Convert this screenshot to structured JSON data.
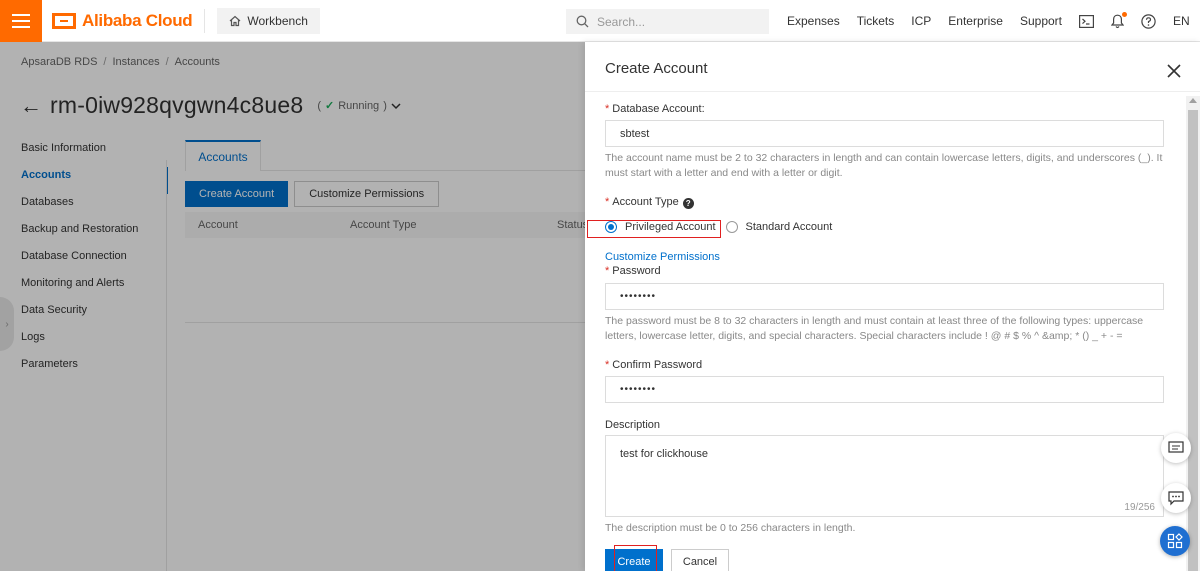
{
  "header": {
    "brand": "Alibaba Cloud",
    "workbench": "Workbench",
    "search_placeholder": "Search...",
    "nav": [
      "Expenses",
      "Tickets",
      "ICP",
      "Enterprise",
      "Support"
    ],
    "language": "EN",
    "accent_color": "#ff6a00"
  },
  "breadcrumb": [
    "ApsaraDB RDS",
    "Instances",
    "Accounts"
  ],
  "instance": {
    "id": "rm-0iw928qvgwn4c8ue8",
    "status": "Running"
  },
  "sidebar": {
    "items": [
      {
        "label": "Basic Information",
        "active": false
      },
      {
        "label": "Accounts",
        "active": true
      },
      {
        "label": "Databases",
        "active": false
      },
      {
        "label": "Backup and Restoration",
        "active": false
      },
      {
        "label": "Database Connection",
        "active": false
      },
      {
        "label": "Monitoring and Alerts",
        "active": false
      },
      {
        "label": "Data Security",
        "active": false
      },
      {
        "label": "Logs",
        "active": false
      },
      {
        "label": "Parameters",
        "active": false
      }
    ]
  },
  "main": {
    "tab": "Accounts",
    "create_button": "Create Account",
    "customize_button": "Customize Permissions",
    "columns": [
      "Account",
      "Account Type",
      "Status"
    ]
  },
  "drawer": {
    "title": "Create Account",
    "db_account": {
      "label": "Database Account:",
      "value": "sbtest",
      "help": "The account name must be 2 to 32 characters in length and can contain lowercase letters, digits, and underscores (_). It must start with a letter and end with a letter or digit."
    },
    "account_type": {
      "label": "Account Type",
      "options": [
        "Privileged Account",
        "Standard Account"
      ],
      "selected": "Privileged Account"
    },
    "customize_link": "Customize Permissions",
    "password": {
      "label": "Password",
      "value": "••••••••",
      "help": "The password must be 8 to 32 characters in length and must contain at least three of the following types: uppercase letters, lowercase letter, digits, and special characters. Special characters include ! @ # $ % ^ &amp; * () _ + - ="
    },
    "confirm_password": {
      "label": "Confirm Password",
      "value": "••••••••"
    },
    "description": {
      "label": "Description",
      "value": "test for clickhouse",
      "counter": "19/256",
      "help": "The description must be 0 to 256 characters in length."
    },
    "create_button": "Create",
    "cancel_button": "Cancel",
    "primary_color": "#0070cc"
  }
}
